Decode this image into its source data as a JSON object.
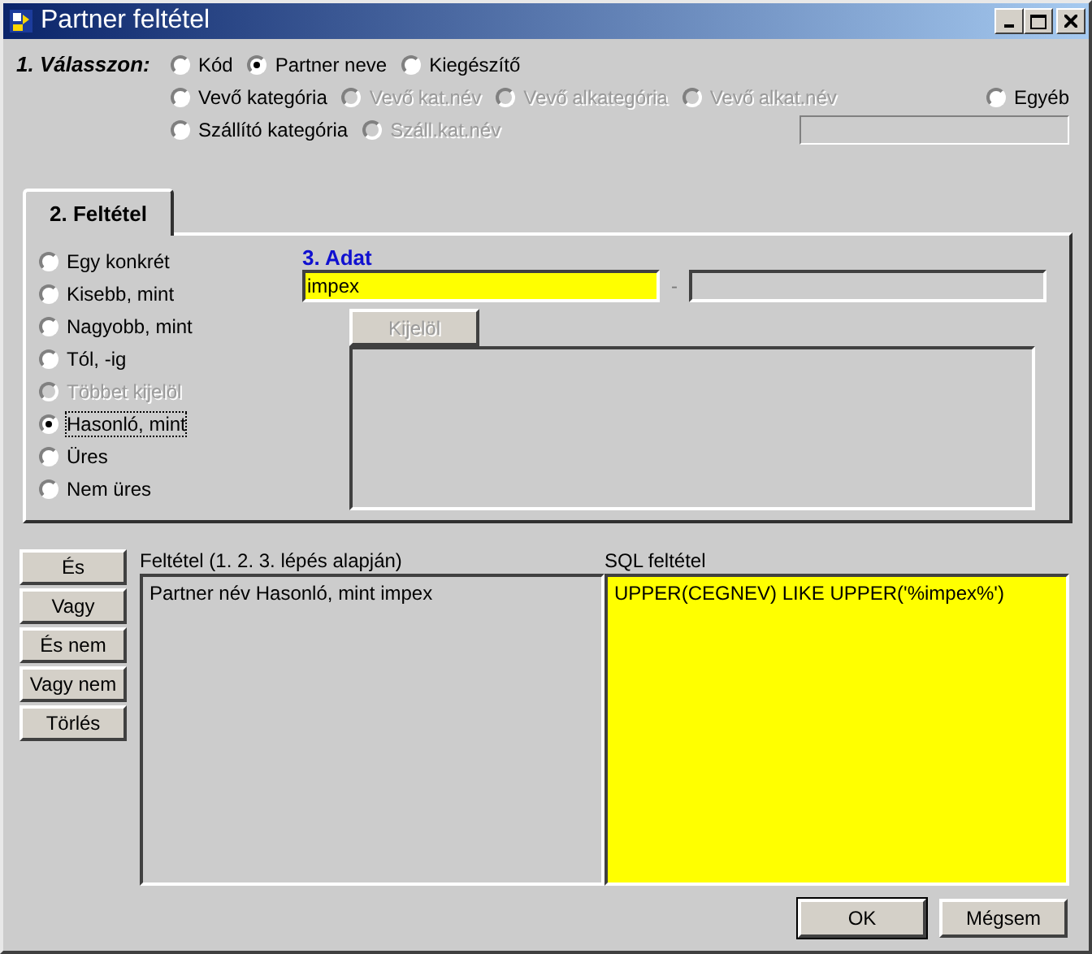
{
  "window": {
    "title": "Partner feltétel"
  },
  "step1": {
    "label": "1. Válasszon:",
    "rows": [
      [
        {
          "label": "Kód",
          "selected": false,
          "disabled": false
        },
        {
          "label": "Partner neve",
          "selected": true,
          "disabled": false
        },
        {
          "label": "Kiegészítő",
          "selected": false,
          "disabled": false
        }
      ],
      [
        {
          "label": "Vevő kategória",
          "selected": false,
          "disabled": false
        },
        {
          "label": "Vevő kat.név",
          "selected": false,
          "disabled": true
        },
        {
          "label": "Vevő alkategória",
          "selected": false,
          "disabled": true
        },
        {
          "label": "Vevő alkat.név",
          "selected": false,
          "disabled": true
        },
        {
          "label": "Egyéb",
          "selected": false,
          "disabled": false,
          "kind": "right"
        }
      ],
      [
        {
          "label": "Szállító kategória",
          "selected": false,
          "disabled": false
        },
        {
          "label": "Száll.kat.név",
          "selected": false,
          "disabled": true
        },
        {
          "kind": "field"
        }
      ]
    ]
  },
  "tab": {
    "label": "2. Feltétel",
    "selected": true
  },
  "conditions": [
    {
      "label": "Egy konkrét",
      "selected": false,
      "disabled": false
    },
    {
      "label": "Kisebb, mint",
      "selected": false,
      "disabled": false
    },
    {
      "label": "Nagyobb, mint",
      "selected": false,
      "disabled": false
    },
    {
      "label": "Tól, -ig",
      "selected": false,
      "disabled": false
    },
    {
      "label": "Többet kijelöl",
      "selected": false,
      "disabled": true
    },
    {
      "label": "Hasonló, mint",
      "selected": true,
      "disabled": false
    },
    {
      "label": "Üres",
      "selected": false,
      "disabled": false
    },
    {
      "label": "Nem üres",
      "selected": false,
      "disabled": false
    }
  ],
  "data": {
    "label": "3. Adat",
    "value": "impex",
    "separator": "-",
    "select_button": {
      "label": "Kijelöl",
      "disabled": true
    }
  },
  "logic_buttons": [
    "És",
    "Vagy",
    "És nem",
    "Vagy nem",
    "Törlés"
  ],
  "condition": {
    "label": "Feltétel (1. 2. 3. lépés alapján)",
    "text": "Partner név Hasonló, mint impex"
  },
  "sql": {
    "label": "SQL feltétel",
    "text": "UPPER(CEGNEV) LIKE UPPER('%impex%')"
  },
  "buttons": [
    {
      "label": "OK",
      "default": true
    },
    {
      "label": "Mégsem",
      "default": false
    }
  ]
}
